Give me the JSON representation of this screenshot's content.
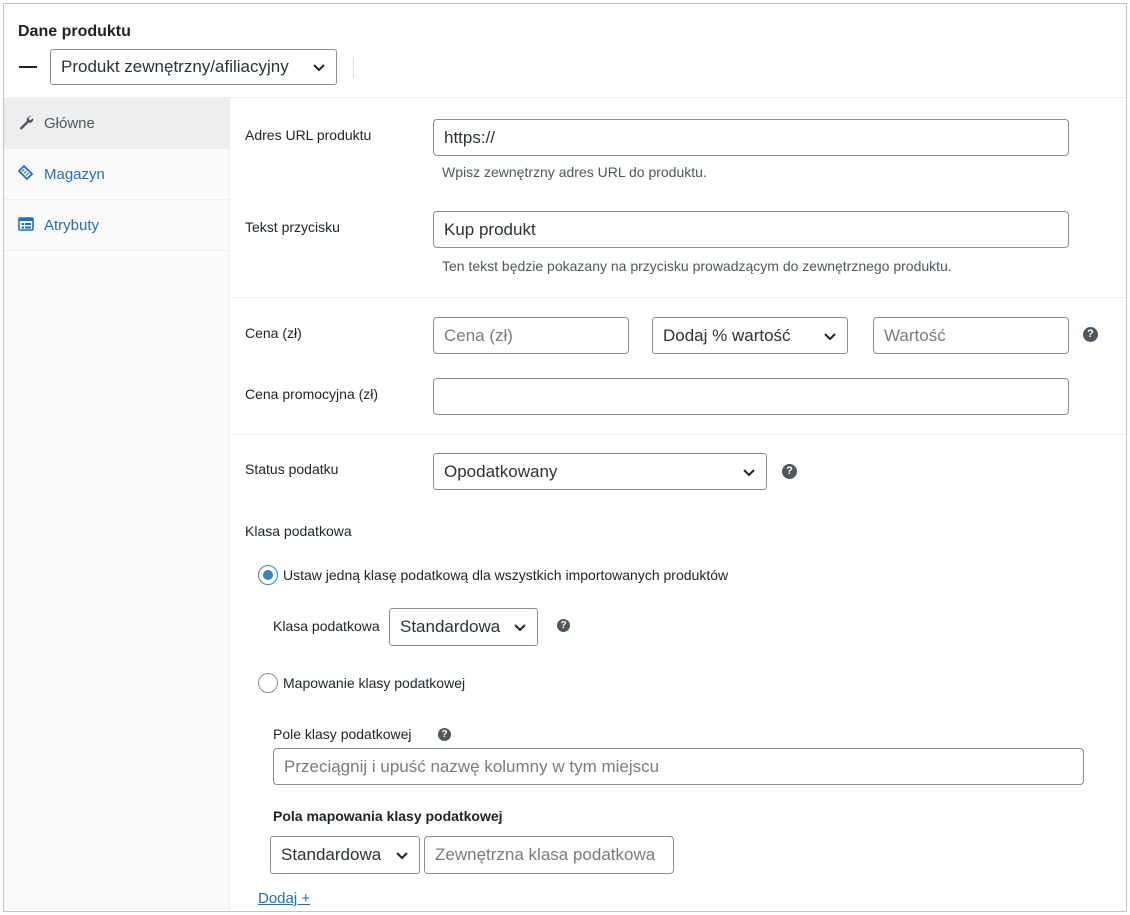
{
  "header": {
    "title": "Dane produktu",
    "product_type": "Produkt zewnętrzny/afiliacyjny"
  },
  "tabs": [
    {
      "label": "Główne",
      "icon": "wrench-icon",
      "active": true
    },
    {
      "label": "Magazyn",
      "icon": "tag-icon",
      "active": false
    },
    {
      "label": "Atrybuty",
      "icon": "list-icon",
      "active": false
    }
  ],
  "general": {
    "url_label": "Adres URL produktu",
    "url_value": "https://",
    "url_desc": "Wpisz zewnętrzny adres URL do produktu.",
    "button_text_label": "Tekst przycisku",
    "button_text_value": "Kup produkt",
    "button_text_desc": "Ten tekst będzie pokazany na przycisku prowadzącym do zewnętrznego produktu.",
    "price_label": "Cena (zł)",
    "price_placeholder": "Cena (zł)",
    "price_modifier": "Dodaj % wartość",
    "price_value_placeholder": "Wartość",
    "sale_price_label": "Cena promocyjna (zł)",
    "tax_status_label": "Status podatku",
    "tax_status_value": "Opodatkowany",
    "tax_class_heading": "Klasa podatkowa",
    "radio_single_label": "Ustaw jedną klasę podatkową dla wszystkich importowanych produktów",
    "tax_class_label": "Klasa podatkowa",
    "tax_class_value": "Standardowa",
    "radio_mapping_label": "Mapowanie klasy podatkowej",
    "tax_class_field_label": "Pole klasy podatkowej",
    "tax_class_field_placeholder": "Przeciągnij i upuść nazwę kolumny w tym miejscu",
    "mapping_fields_heading": "Pola mapowania klasy podatkowej",
    "mapping_select_value": "Standardowa",
    "mapping_external_placeholder": "Zewnętrzna klasa podatkowa",
    "add_link": "Dodaj +"
  },
  "colors": {
    "accent": "#2271b1",
    "radio_selected": "#3582c4",
    "border": "#8c8f94"
  }
}
